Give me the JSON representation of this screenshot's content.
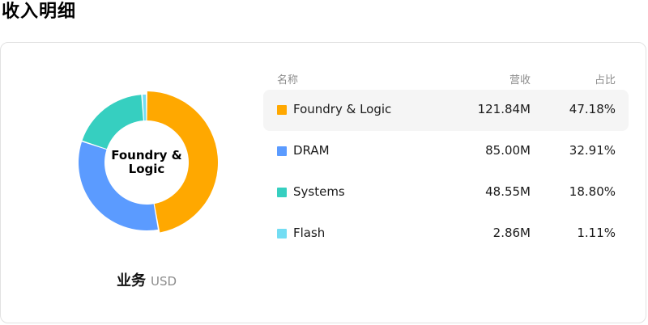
{
  "title": "收入明细",
  "caption": {
    "main": "业务",
    "unit": "USD"
  },
  "center_label": "Foundry & Logic",
  "table": {
    "headers": {
      "name": "名称",
      "revenue": "营收",
      "share": "占比"
    },
    "rows": [
      {
        "name": "Foundry & Logic",
        "revenue": "121.84M",
        "share": "47.18%",
        "color": "#FFA800",
        "active": true
      },
      {
        "name": "DRAM",
        "revenue": "85.00M",
        "share": "32.91%",
        "color": "#5B9BFF",
        "active": false
      },
      {
        "name": "Systems",
        "revenue": "48.55M",
        "share": "18.80%",
        "color": "#36CFC0",
        "active": false
      },
      {
        "name": "Flash",
        "revenue": "2.86M",
        "share": "1.11%",
        "color": "#73DDF3",
        "active": false
      }
    ]
  },
  "chart_data": {
    "type": "pie",
    "donut": true,
    "categories": [
      "Foundry & Logic",
      "DRAM",
      "Systems",
      "Flash"
    ],
    "values": [
      121.84,
      85.0,
      48.55,
      2.86
    ],
    "percentages": [
      47.18,
      32.91,
      18.8,
      1.11
    ],
    "colors": [
      "#FFA800",
      "#5B9BFF",
      "#36CFC0",
      "#73DDF3"
    ],
    "highlighted": "Foundry & Logic",
    "title": "",
    "unit": "USD"
  }
}
